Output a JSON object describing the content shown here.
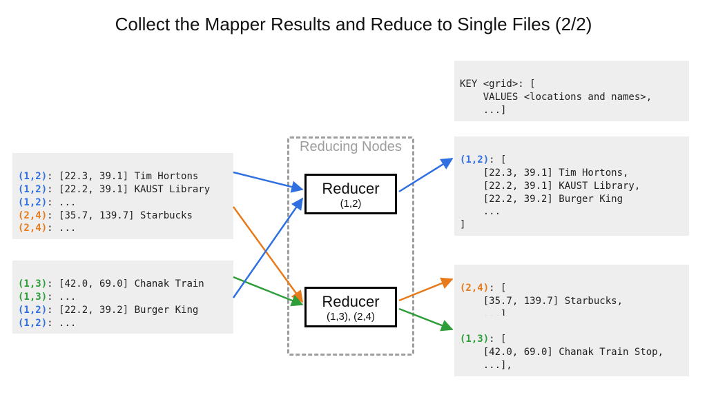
{
  "title": "Collect the Mapper Results and Reduce to Single Files (2/2)",
  "keys": {
    "k12": "(1,2)",
    "k13": "(1,3)",
    "k24": "(2,4)"
  },
  "schema": {
    "l1": "KEY <grid>: [",
    "l2": "    VALUES <locations and names>,",
    "l3": "    ...]"
  },
  "mapper1": {
    "l1b": ": [22.3, 39.1] Tim Hortons",
    "l2b": ": [22.2, 39.1] KAUST Library",
    "l3b": ": ...",
    "l4b": ": [35.7, 139.7] Starbucks",
    "l5b": ": ..."
  },
  "mapper2": {
    "l1b": ": [42.0, 69.0] Chanak Train",
    "l2b": ": ...",
    "l3b": ": [22.2, 39.2] Burger King",
    "l4b": ": ..."
  },
  "reducing_label": "Reducing Nodes",
  "reducer1": {
    "title": "Reducer",
    "sub": "(1,2)"
  },
  "reducer2": {
    "title": "Reducer",
    "sub": "(1,3), (2,4)"
  },
  "out12": {
    "l1b": ": [",
    "l2": "    [22.3, 39.1] Tim Hortons,",
    "l3": "    [22.2, 39.1] KAUST Library,",
    "l4": "    [22.2, 39.2] Burger King",
    "l5": "    ...",
    "l6": "]"
  },
  "out24": {
    "l1b": ": [",
    "l2": "    [35.7, 139.7] Starbucks,",
    "l3": "    ...]"
  },
  "out13": {
    "l1b": ": [",
    "l2": "    [42.0, 69.0] Chanak Train Stop,",
    "l3": "    ...],"
  }
}
